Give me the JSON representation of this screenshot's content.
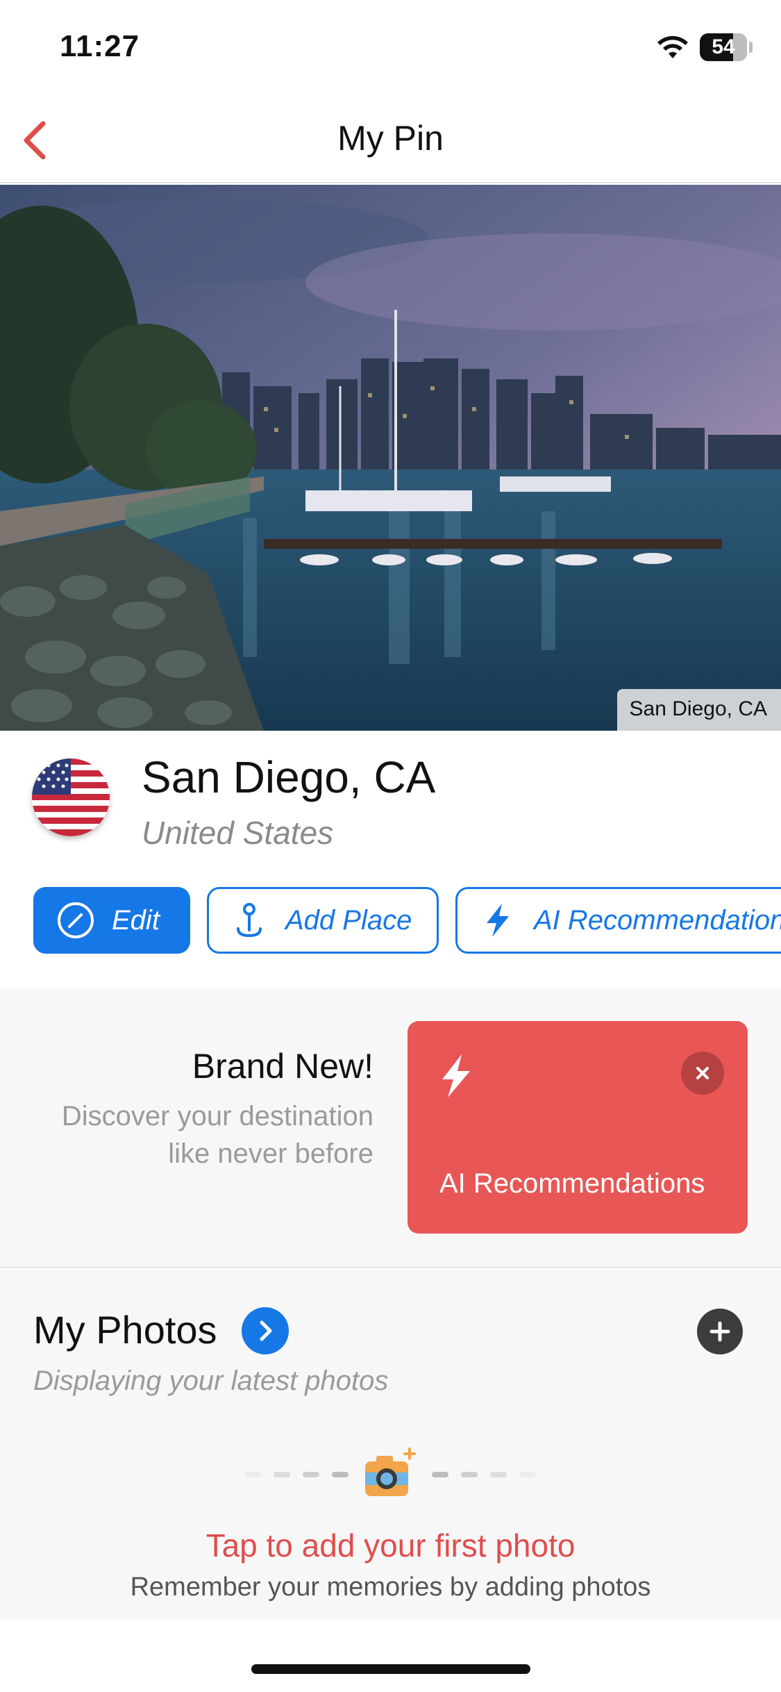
{
  "status_bar": {
    "time": "11:27",
    "battery": "54"
  },
  "nav": {
    "title": "My Pin",
    "back_icon": "chevron-left-icon"
  },
  "hero": {
    "caption": "San Diego, CA"
  },
  "place": {
    "name": "San Diego, CA",
    "country": "United States",
    "flag_icon": "us-flag-icon"
  },
  "actions": {
    "edit_label": "Edit",
    "add_place_label": "Add Place",
    "ai_label": "AI Recommendations"
  },
  "promo": {
    "title": "Brand New!",
    "description": "Discover your destination like never before",
    "card_label": "AI Recommendations"
  },
  "photos": {
    "title": "My Photos",
    "subtitle": "Displaying your latest photos",
    "cta": "Tap to add your first photo",
    "cta_sub": "Remember your memories by adding photos"
  },
  "colors": {
    "accent_blue": "#1677e6",
    "accent_red": "#e85656",
    "back_red": "#e04d4d"
  }
}
